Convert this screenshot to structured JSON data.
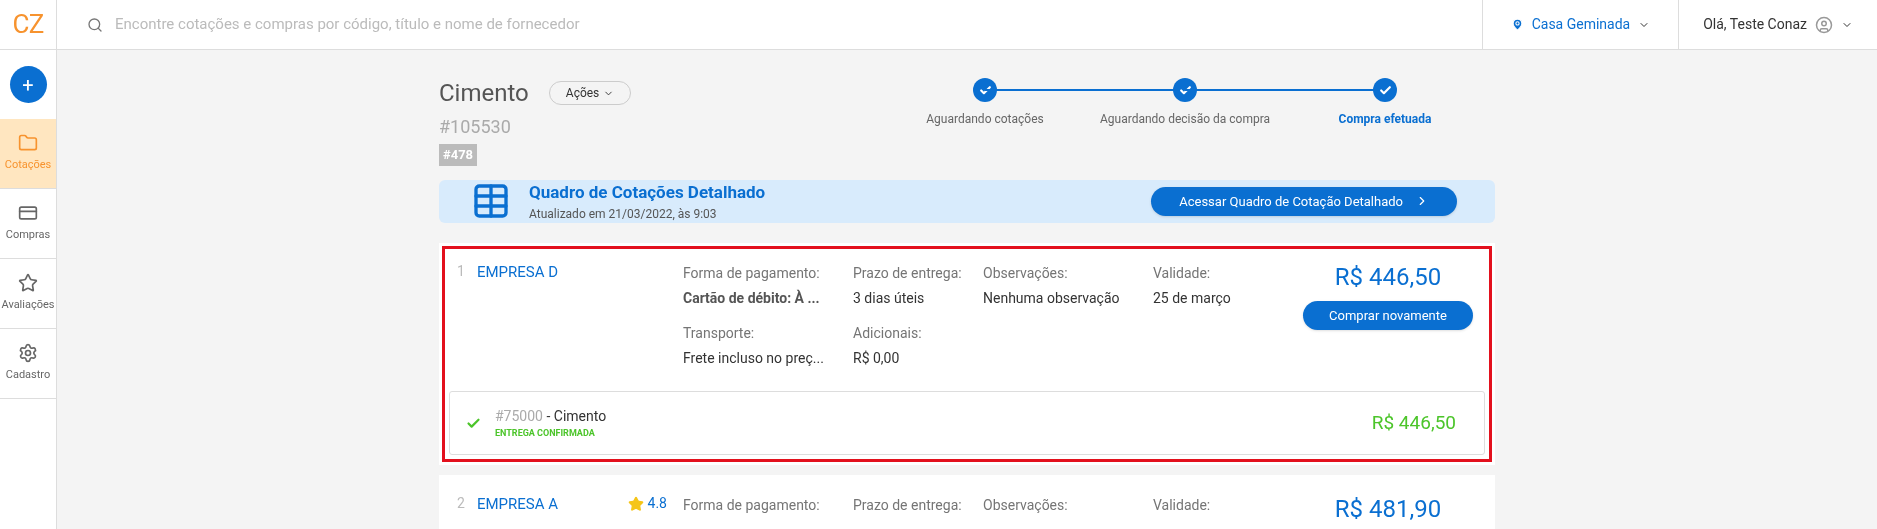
{
  "logo": "CZ",
  "search": {
    "placeholder": "Encontre cotações e compras por código, título e nome de fornecedor"
  },
  "location": {
    "label": "Casa Geminada"
  },
  "user": {
    "greeting": "Olá, Teste Conaz"
  },
  "sidebar": {
    "add_button": "+",
    "items": [
      {
        "label": "Cotações",
        "kind": "folder",
        "selected": true
      },
      {
        "label": "Compras",
        "kind": "card",
        "selected": false
      },
      {
        "label": "Avaliações",
        "kind": "star",
        "selected": false
      },
      {
        "label": "Cadastro",
        "kind": "gear",
        "selected": false
      }
    ]
  },
  "header": {
    "title": "Cimento",
    "actions": "Ações",
    "code": "#105530",
    "tag": "#478"
  },
  "steps": [
    {
      "label": "Aguardando cotações",
      "done": true,
      "selected": false
    },
    {
      "label": "Aguardando decisão da compra",
      "done": true,
      "selected": false
    },
    {
      "label": "Compra efetuada",
      "done": true,
      "selected": true
    }
  ],
  "banner": {
    "title": "Quadro de Cotações Detalhado",
    "subtitle": "Atualizado em 21/03/2022, às 9:03",
    "button": "Acessar Quadro de Cotação Detalhado"
  },
  "quotes": [
    {
      "index": "1",
      "supplier": "EMPRESA D",
      "highlighted": true,
      "fields": [
        {
          "label": "Forma de pagamento:",
          "value": "Cartão de débito: À ...",
          "bold": true
        },
        {
          "label": "Prazo de entrega:",
          "value": "3 dias úteis",
          "bold": false
        },
        {
          "label": "Observações:",
          "value": "Nenhuma observação",
          "bold": false
        },
        {
          "label": "Validade:",
          "value": "25 de março",
          "bold": false
        },
        {
          "label": "Transporte:",
          "value": "Frete incluso no preç...",
          "bold": false
        },
        {
          "label": "Adicionais:",
          "value": "R$ 0,00",
          "bold": false
        }
      ],
      "price": "R$ 446,50",
      "button": "Comprar novamente",
      "items": [
        {
          "code": "#75000",
          "name": " - Cimento",
          "status": "ENTREGA CONFIRMADA",
          "confirmed": true,
          "price": "R$ 446,50"
        }
      ]
    },
    {
      "index": "2",
      "supplier": "EMPRESA A",
      "rating": "4.8",
      "highlighted": false,
      "fields": [
        {
          "label": "Forma de pagamento:"
        },
        {
          "label": "Prazo de entrega:"
        },
        {
          "label": "Observações:"
        },
        {
          "label": "Validade:"
        }
      ],
      "price": "R$ 481,90"
    }
  ]
}
